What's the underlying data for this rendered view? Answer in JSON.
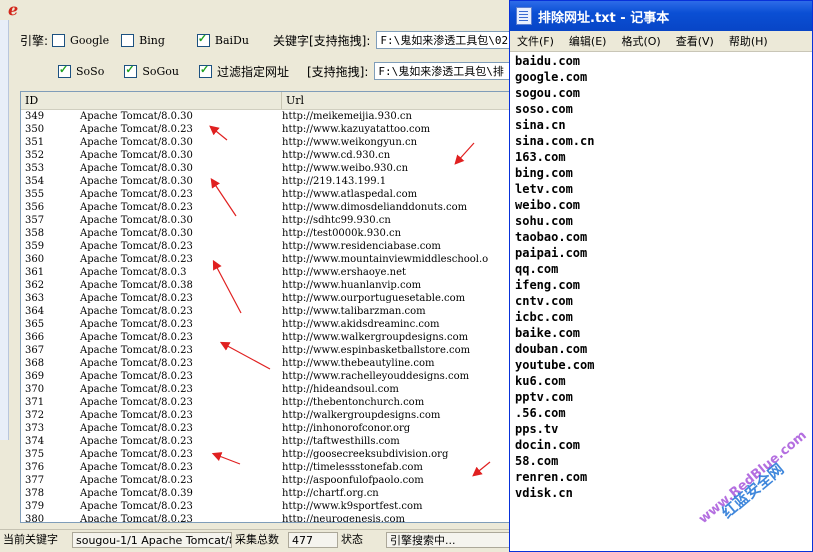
{
  "app": {
    "engine_label": "引擎:",
    "engines": [
      {
        "label": "Google",
        "checked": false
      },
      {
        "label": "Bing",
        "checked": false
      },
      {
        "label": "BaiDu",
        "checked": true
      },
      {
        "label": "SoSo",
        "checked": true
      },
      {
        "label": "SoGou",
        "checked": true
      }
    ],
    "filter_label": "过滤指定网址",
    "filter_checked": true,
    "keyword_label": "关键字[支持拖拽]:",
    "keyword_path": "F:\\鬼如来渗透工具包\\02",
    "filter_drag_label": "[支持拖拽]:",
    "filter_path": "F:\\鬼如来渗透工具包\\排",
    "table": {
      "columns": [
        "ID",
        "Url"
      ],
      "rows": [
        {
          "id": "349",
          "server": "Apache Tomcat/8.0.30",
          "url": "http://meikemeijia.930.cn"
        },
        {
          "id": "350",
          "server": "Apache Tomcat/8.0.23",
          "url": "http://www.kazuyatattoo.com"
        },
        {
          "id": "351",
          "server": "Apache Tomcat/8.0.30",
          "url": "http://www.weikongyun.cn"
        },
        {
          "id": "352",
          "server": "Apache Tomcat/8.0.30",
          "url": "http://www.cd.930.cn"
        },
        {
          "id": "353",
          "server": "Apache Tomcat/8.0.30",
          "url": "http://www.weibo.930.cn"
        },
        {
          "id": "354",
          "server": "Apache Tomcat/8.0.30",
          "url": "http://219.143.199.1"
        },
        {
          "id": "355",
          "server": "Apache Tomcat/8.0.23",
          "url": "http://www.atlaspedal.com"
        },
        {
          "id": "356",
          "server": "Apache Tomcat/8.0.23",
          "url": "http://www.dimosdelianddonuts.com"
        },
        {
          "id": "357",
          "server": "Apache Tomcat/8.0.30",
          "url": "http://sdhtc99.930.cn"
        },
        {
          "id": "358",
          "server": "Apache Tomcat/8.0.30",
          "url": "http://test0000k.930.cn"
        },
        {
          "id": "359",
          "server": "Apache Tomcat/8.0.23",
          "url": "http://www.residenciabase.com"
        },
        {
          "id": "360",
          "server": "Apache Tomcat/8.0.23",
          "url": "http://www.mountainviewmiddleschool.o"
        },
        {
          "id": "361",
          "server": "Apache Tomcat/8.0.3",
          "url": "http://www.ershaoye.net"
        },
        {
          "id": "362",
          "server": "Apache Tomcat/8.0.38",
          "url": "http://www.huanlanvip.com"
        },
        {
          "id": "363",
          "server": "Apache Tomcat/8.0.23",
          "url": "http://www.ourportuguesetable.com"
        },
        {
          "id": "364",
          "server": "Apache Tomcat/8.0.23",
          "url": "http://www.talibarzman.com"
        },
        {
          "id": "365",
          "server": "Apache Tomcat/8.0.23",
          "url": "http://www.akidsdreaminc.com"
        },
        {
          "id": "366",
          "server": "Apache Tomcat/8.0.23",
          "url": "http://www.walkergroupdesigns.com"
        },
        {
          "id": "367",
          "server": "Apache Tomcat/8.0.23",
          "url": "http://www.espinbasketballstore.com"
        },
        {
          "id": "368",
          "server": "Apache Tomcat/8.0.23",
          "url": "http://www.thebeautyline.com"
        },
        {
          "id": "369",
          "server": "Apache Tomcat/8.0.23",
          "url": "http://www.rachelleyouddesigns.com"
        },
        {
          "id": "370",
          "server": "Apache Tomcat/8.0.23",
          "url": "http://hideandsoul.com"
        },
        {
          "id": "371",
          "server": "Apache Tomcat/8.0.23",
          "url": "http://thebentonchurch.com"
        },
        {
          "id": "372",
          "server": "Apache Tomcat/8.0.23",
          "url": "http://walkergroupdesigns.com"
        },
        {
          "id": "373",
          "server": "Apache Tomcat/8.0.23",
          "url": "http://inhonorofconor.org"
        },
        {
          "id": "374",
          "server": "Apache Tomcat/8.0.23",
          "url": "http://taftwesthills.com"
        },
        {
          "id": "375",
          "server": "Apache Tomcat/8.0.23",
          "url": "http://goosecreeksubdivision.org"
        },
        {
          "id": "376",
          "server": "Apache Tomcat/8.0.23",
          "url": "http://timelessstonefab.com"
        },
        {
          "id": "377",
          "server": "Apache Tomcat/8.0.23",
          "url": "http://aspoonfulofpaolo.com"
        },
        {
          "id": "378",
          "server": "Apache Tomcat/8.0.39",
          "url": "http://chartf.org.cn"
        },
        {
          "id": "379",
          "server": "Apache Tomcat/8.0.23",
          "url": "http://www.k9sportfest.com"
        },
        {
          "id": "380",
          "server": "Apache Tomcat/8.0.23",
          "url": "http://neurogenesis.com"
        }
      ]
    },
    "status": {
      "keyword_label": "当前关键字",
      "keyword_value": "sougou-1/1 Apache Tomcat/8",
      "total_label": "采集总数",
      "total_value": "477",
      "state_label": "状态",
      "state_value": "引擎搜索中..."
    }
  },
  "notepad": {
    "title": "排除网址.txt - 记事本",
    "menu": [
      "文件(F)",
      "编辑(E)",
      "格式(O)",
      "查看(V)",
      "帮助(H)"
    ],
    "lines": [
      "baidu.com",
      "google.com",
      "sogou.com",
      "soso.com",
      "sina.cn",
      "sina.com.cn",
      "163.com",
      "bing.com",
      "letv.com",
      "weibo.com",
      "sohu.com",
      "taobao.com",
      "paipai.com",
      "qq.com",
      "ifeng.com",
      "cntv.com",
      "icbc.com",
      "baike.com",
      "douban.com",
      "youtube.com",
      "ku6.com",
      "pptv.com",
      ".56.com",
      "pps.tv",
      "docin.com",
      "58.com",
      "renren.com",
      "vdisk.cn"
    ]
  },
  "watermark": {
    "text1": "www.RedBlue.com",
    "text2": "红蓝安全网"
  },
  "colors": {
    "accent": "#0a4fd4",
    "arrow": "#e02020"
  }
}
